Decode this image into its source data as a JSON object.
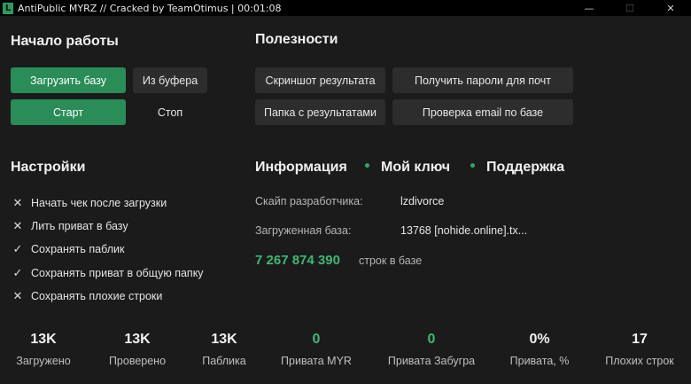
{
  "window": {
    "title": "AntiPublic MYRZ // Cracked by TeamOtimus | 00:01:08",
    "icon_letter": "L",
    "minimize": "—",
    "maximize": "☐",
    "close": "✕"
  },
  "start_section": {
    "title": "Начало работы",
    "load_base": "Загрузить базу",
    "from_buffer": "Из буфера",
    "start": "Старт",
    "stop": "Стоп"
  },
  "utilities": {
    "title": "Полезности",
    "screenshot": "Скриншот результата",
    "get_passwords": "Получить пароли для почт",
    "results_folder": "Папка с результатами",
    "check_email": "Проверка email по базе"
  },
  "settings": {
    "title": "Настройки",
    "items": [
      {
        "label": "Начать чек после загрузки",
        "checked": false,
        "mark": "✕"
      },
      {
        "label": "Лить приват в базу",
        "checked": false,
        "mark": "✕"
      },
      {
        "label": "Сохранять паблик",
        "checked": true,
        "mark": "✓"
      },
      {
        "label": "Сохранять приват в общую папку",
        "checked": true,
        "mark": "✓"
      },
      {
        "label": "Сохранять плохие строки",
        "checked": false,
        "mark": "✕"
      }
    ]
  },
  "info": {
    "tab_info": "Информация",
    "tab_key": "Мой ключ",
    "tab_support": "Поддержка",
    "dot": "•",
    "dev_skype_label": "Скайп разработчика:",
    "dev_skype_value": "lzdivorce",
    "loaded_base_label": "Загруженная база:",
    "loaded_base_value": "13768 [nohide.online].tx...",
    "rows_count": "7 267 874 390",
    "rows_caption": "строк в базе"
  },
  "stats": [
    {
      "value": "13K",
      "label": "Загружено",
      "green": false
    },
    {
      "value": "13K",
      "label": "Проверено",
      "green": false
    },
    {
      "value": "13K",
      "label": "Паблика",
      "green": false
    },
    {
      "value": "0",
      "label": "Привата MYR",
      "green": true
    },
    {
      "value": "0",
      "label": "Привата Забугра",
      "green": true
    },
    {
      "value": "0%",
      "label": "Привата, %",
      "green": false
    },
    {
      "value": "17",
      "label": "Плохих строк",
      "green": false
    }
  ],
  "colors": {
    "background": "#1b1b1b",
    "accent_green": "#2a8c57",
    "green_text": "#3db872",
    "button_gray": "#2d2d2d"
  }
}
